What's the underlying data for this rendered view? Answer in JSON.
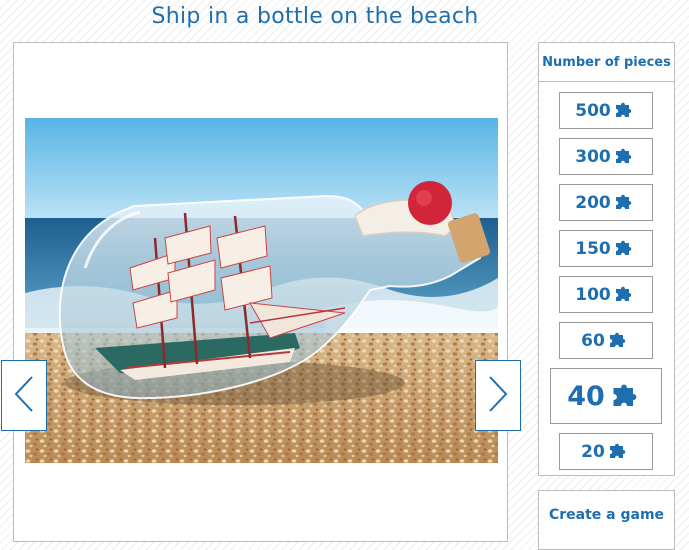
{
  "page": {
    "title": "Ship in a bottle on the beach"
  },
  "accent_color": "#1f6fb0",
  "preview": {
    "image_alt": "Ship in a bottle on the beach",
    "prev_icon": "chevron-left-icon",
    "next_icon": "chevron-right-icon"
  },
  "pieces": {
    "header": "Number of pieces",
    "icon": "puzzle-piece-icon",
    "selected": "40",
    "options": [
      {
        "label": "500"
      },
      {
        "label": "300"
      },
      {
        "label": "200"
      },
      {
        "label": "150"
      },
      {
        "label": "100"
      },
      {
        "label": "60"
      },
      {
        "label": "40"
      },
      {
        "label": "20"
      }
    ]
  },
  "actions": {
    "create_game": "Create a game"
  }
}
